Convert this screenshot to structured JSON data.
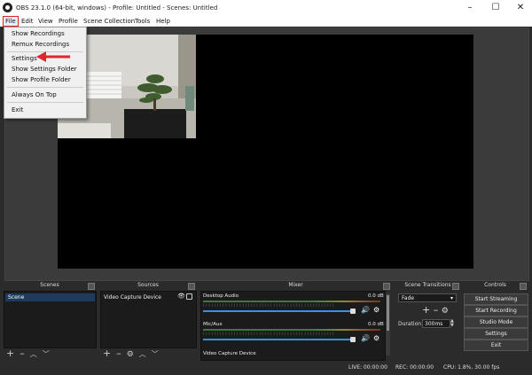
{
  "window": {
    "title": "OBS 23.1.0 (64-bit, windows) - Profile: Untitled - Scenes: Untitled"
  },
  "menu": [
    "File",
    "Edit",
    "View",
    "Profile",
    "Scene Collection",
    "Tools",
    "Help"
  ],
  "file_menu": [
    "Show Recordings",
    "Remux Recordings",
    "Settings",
    "Show Settings Folder",
    "Show Profile Folder",
    "Always On Top",
    "Exit"
  ],
  "docks": {
    "scenes": {
      "title": "Scenes",
      "items": [
        "Scene"
      ]
    },
    "sources": {
      "title": "Sources",
      "items": [
        "Video Capture Device"
      ]
    },
    "mixer": {
      "title": "Mixer",
      "channels": [
        {
          "name": "Desktop Audio",
          "db": "0.0 dB"
        },
        {
          "name": "Mic/Aux",
          "db": "0.0 dB"
        },
        {
          "name": "Video Capture Device"
        }
      ]
    },
    "transitions": {
      "title": "Scene Transitions",
      "selected": "Fade",
      "duration_label": "Duration",
      "duration": "300ms"
    },
    "controls": {
      "title": "Controls",
      "buttons": [
        "Start Streaming",
        "Start Recording",
        "Studio Mode",
        "Settings",
        "Exit"
      ]
    }
  },
  "status": {
    "live": "LIVE: 00:00:00",
    "rec": "REC: 00:00:00",
    "cpu": "CPU: 1.8%, 30.00 fps"
  },
  "colors": {
    "annotation": "#e0262a",
    "slider": "#3c8fe4",
    "selection": "#1e3a5c"
  }
}
